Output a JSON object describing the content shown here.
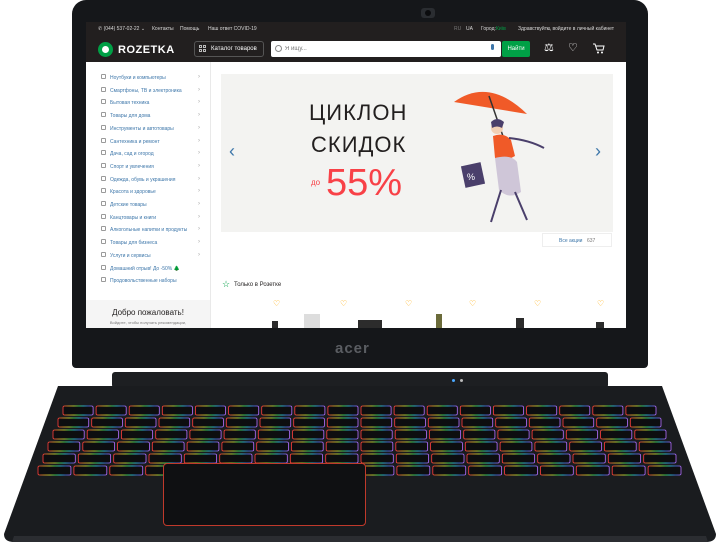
{
  "device": {
    "brand": "acer"
  },
  "topbar": {
    "phone": "(044) 537-02-22",
    "contacts": "Контакты",
    "help": "Помощь",
    "covid": "Наш ответ COVID-19",
    "lang_ru": "RU",
    "lang_ua": "UA",
    "city_label": "Город:",
    "city": "Київ",
    "greeting": "Здравствуйте,",
    "login": "войдите в личный кабинет"
  },
  "header": {
    "logo": "ROZETKA",
    "catalog_label": "Каталог товаров",
    "search_placeholder": "Я ищу...",
    "find_label": "Найти"
  },
  "sidebar": {
    "items": [
      {
        "label": "Ноутбуки и компьютеры"
      },
      {
        "label": "Смартфоны, ТВ и электроника"
      },
      {
        "label": "Бытовая техника"
      },
      {
        "label": "Товары для дома"
      },
      {
        "label": "Инструменты и автотовары"
      },
      {
        "label": "Сантехника и ремонт"
      },
      {
        "label": "Дача, сад и огород"
      },
      {
        "label": "Спорт и увлечения"
      },
      {
        "label": "Одежда, обувь и украшения"
      },
      {
        "label": "Красота и здоровье"
      },
      {
        "label": "Детские товары"
      },
      {
        "label": "Канцтовары и книги"
      },
      {
        "label": "Алкогольные напитки и продукты"
      },
      {
        "label": "Товары для бизнеса"
      },
      {
        "label": "Услуги и сервисы"
      },
      {
        "label": "Домашний отрыв! До -50% 🌲"
      },
      {
        "label": "Продовольственные наборы"
      }
    ],
    "welcome_title": "Добро пожаловать!",
    "welcome_sub": "Войдите, чтобы получать рекомендации,"
  },
  "banner": {
    "line1": "ЦИКЛОН",
    "line2": "СКИДОК",
    "prefix": "до",
    "percent": "55%",
    "bag_symbol": "%",
    "all_actions_label": "Все акции",
    "all_actions_count": "637"
  },
  "section": {
    "title": "Только в Розетке"
  },
  "colors": {
    "brand_green": "#00a046",
    "header_dark": "#221f1f",
    "link_blue": "#3e77aa",
    "sale_red": "#f84147",
    "wishlist_yellow": "#ffa900"
  }
}
